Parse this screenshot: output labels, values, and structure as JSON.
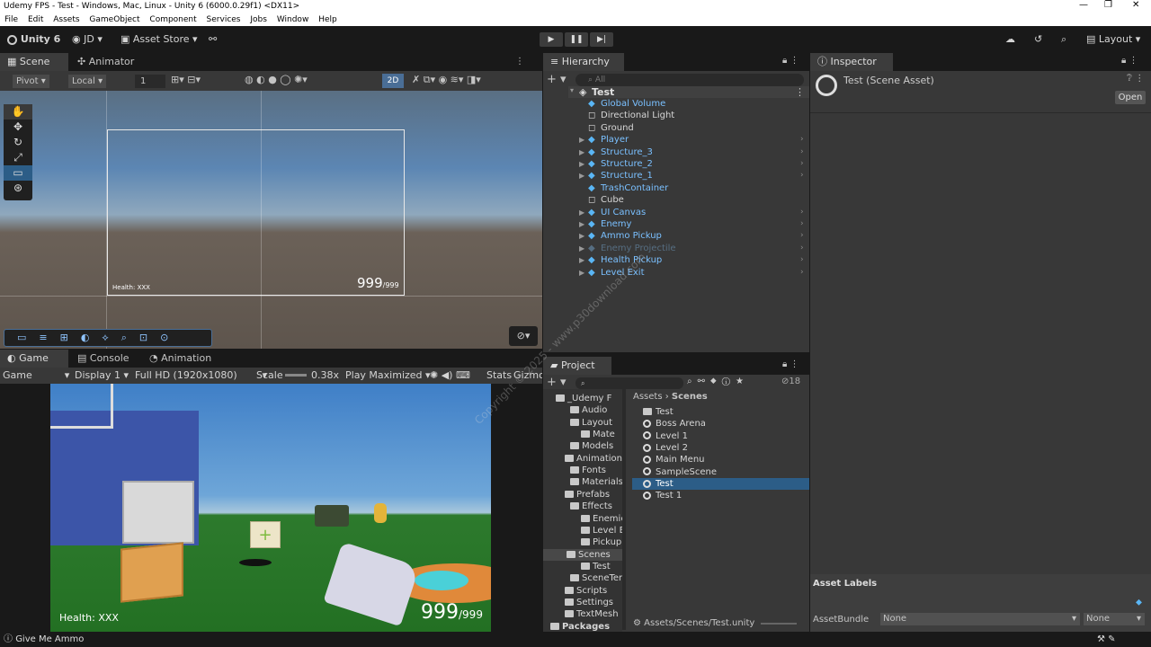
{
  "window": {
    "title": "Udemy FPS - Test - Windows, Mac, Linux - Unity 6 (6000.0.29f1) <DX11>",
    "minimize": "—",
    "maximize": "❐",
    "close": "✕"
  },
  "menu": [
    "File",
    "Edit",
    "Assets",
    "GameObject",
    "Component",
    "Services",
    "Jobs",
    "Window",
    "Help"
  ],
  "toolbar": {
    "unity": "Unity 6",
    "account": "JD",
    "asset_store": "Asset Store",
    "layout": "Layout"
  },
  "scene_tabs": {
    "scene": "Scene",
    "animator": "Animator"
  },
  "scene_toolbar": {
    "pivot": "Pivot",
    "local": "Local",
    "grid_num": "1",
    "mode_2d": "2D"
  },
  "scene_view": {
    "health": "Health: XXX",
    "ammo": "999",
    "ammo_max": "/999"
  },
  "game_tabs": {
    "game": "Game",
    "console": "Console",
    "animation": "Animation"
  },
  "game_toolbar": {
    "mode": "Game",
    "display": "Display 1",
    "resolution": "Full HD (1920x1080)",
    "scale_label": "Scale",
    "scale_value": "0.38x",
    "play_mode": "Play Maximized",
    "stats": "Stats",
    "gizmos": "Gizmos"
  },
  "game_view": {
    "health": "Health: XXX",
    "ammo": "999",
    "ammo_max": "/999"
  },
  "hierarchy": {
    "tab": "Hierarchy",
    "search_placeholder": "All",
    "scene": "Test",
    "items": [
      {
        "label": "Global Volume",
        "type": "prefab",
        "arrow": false
      },
      {
        "label": "Directional Light",
        "type": "plain",
        "arrow": false
      },
      {
        "label": "Ground",
        "type": "plain",
        "arrow": false
      },
      {
        "label": "Player",
        "type": "prefab",
        "arrow": true
      },
      {
        "label": "Structure_3",
        "type": "prefab",
        "arrow": true
      },
      {
        "label": "Structure_2",
        "type": "prefab",
        "arrow": true
      },
      {
        "label": "Structure_1",
        "type": "prefab",
        "arrow": true
      },
      {
        "label": "TrashContainer",
        "type": "prefab",
        "arrow": false
      },
      {
        "label": "Cube",
        "type": "plain",
        "arrow": false
      },
      {
        "label": "UI Canvas",
        "type": "prefab",
        "arrow": true
      },
      {
        "label": "Enemy",
        "type": "prefab",
        "arrow": true
      },
      {
        "label": "Ammo Pickup",
        "type": "prefab",
        "arrow": true
      },
      {
        "label": "Enemy Projectile",
        "type": "dim",
        "arrow": true
      },
      {
        "label": "Health Pickup",
        "type": "prefab",
        "arrow": true
      },
      {
        "label": "Level Exit",
        "type": "prefab",
        "arrow": true
      }
    ]
  },
  "project": {
    "tab": "Project",
    "count": "18",
    "breadcrumb": [
      "Assets",
      "Scenes"
    ],
    "tree": [
      "_Udemy F",
      "Audio",
      "Layout",
      "Mate",
      "Models",
      "Animation",
      "Fonts",
      "Materials",
      "Prefabs",
      "Effects",
      "Enemie",
      "Level E",
      "Pickup",
      "Scenes",
      "Test",
      "SceneTer",
      "Scripts",
      "Settings",
      "TextMesh",
      "Packages"
    ],
    "files": [
      {
        "name": "Test",
        "kind": "folder"
      },
      {
        "name": "Boss Arena",
        "kind": "scene"
      },
      {
        "name": "Level 1",
        "kind": "scene"
      },
      {
        "name": "Level 2",
        "kind": "scene"
      },
      {
        "name": "Main Menu",
        "kind": "scene"
      },
      {
        "name": "SampleScene",
        "kind": "scene"
      },
      {
        "name": "Test",
        "kind": "scene",
        "selected": true
      },
      {
        "name": "Test 1",
        "kind": "scene"
      }
    ],
    "path": "Assets/Scenes/Test.unity"
  },
  "inspector": {
    "tab": "Inspector",
    "title": "Test (Scene Asset)",
    "open": "Open",
    "asset_labels": "Asset Labels",
    "asset_bundle": "AssetBundle",
    "bundle_value": "None",
    "variant_value": "None"
  },
  "status": {
    "message": "Give Me Ammo"
  },
  "watermark": "Copyright © 2025 - www.p30download.com",
  "colors": {
    "selection": "#2c5d87",
    "prefab_blue": "#7ac0ff",
    "panel": "#383838",
    "accent_play": "#5ab6f5"
  }
}
